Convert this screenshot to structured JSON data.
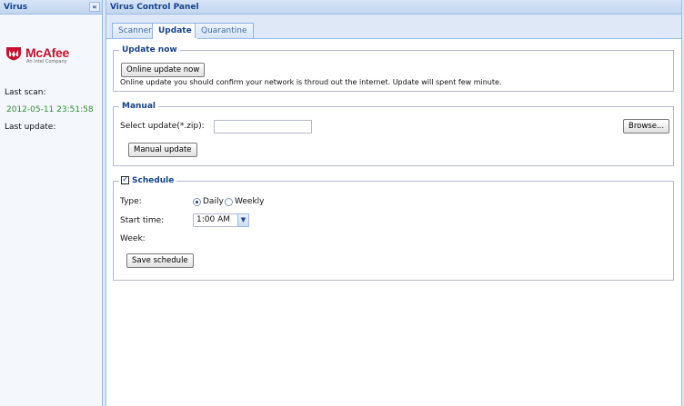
{
  "left_panel": {
    "title": "Virus",
    "collapse_glyph": "«",
    "logo": {
      "brand": "McAfee",
      "tagline": "An Intel Company"
    },
    "last_scan_label": "Last scan:",
    "last_scan_value": "2012-05-11 23:51:58",
    "last_update_label": "Last update:"
  },
  "right_panel": {
    "title": "Virus Control Panel",
    "tabs": [
      {
        "label": "Scanner",
        "active": false
      },
      {
        "label": "Update",
        "active": true
      },
      {
        "label": "Quarantine",
        "active": false
      }
    ],
    "update_now": {
      "legend": "Update now",
      "button": "Online update now",
      "note": "Online update you should confirm your network is throud out the internet. Update will spent few minute."
    },
    "manual": {
      "legend": "Manual",
      "select_label": "Select update(*.zip):",
      "file_value": "",
      "browse_button": "Browse...",
      "update_button": "Manual update"
    },
    "schedule": {
      "legend": "Schedule",
      "enabled": true,
      "type_label": "Type:",
      "type_options": [
        "Daily",
        "Weekly"
      ],
      "type_selected": "Daily",
      "start_time_label": "Start time:",
      "start_time_value": "1:00 AM",
      "week_label": "Week:",
      "save_button": "Save schedule"
    }
  },
  "colors": {
    "header_text": "#15428b",
    "accent_border": "#99bbe8",
    "scan_time": "#2e8b2e",
    "brand_red": "#c8102e"
  },
  "icons": {
    "collapse": "double-chevron-left-icon",
    "logo_mark": "mcafee-shield-icon",
    "combo_trigger": "chevron-down-icon"
  }
}
